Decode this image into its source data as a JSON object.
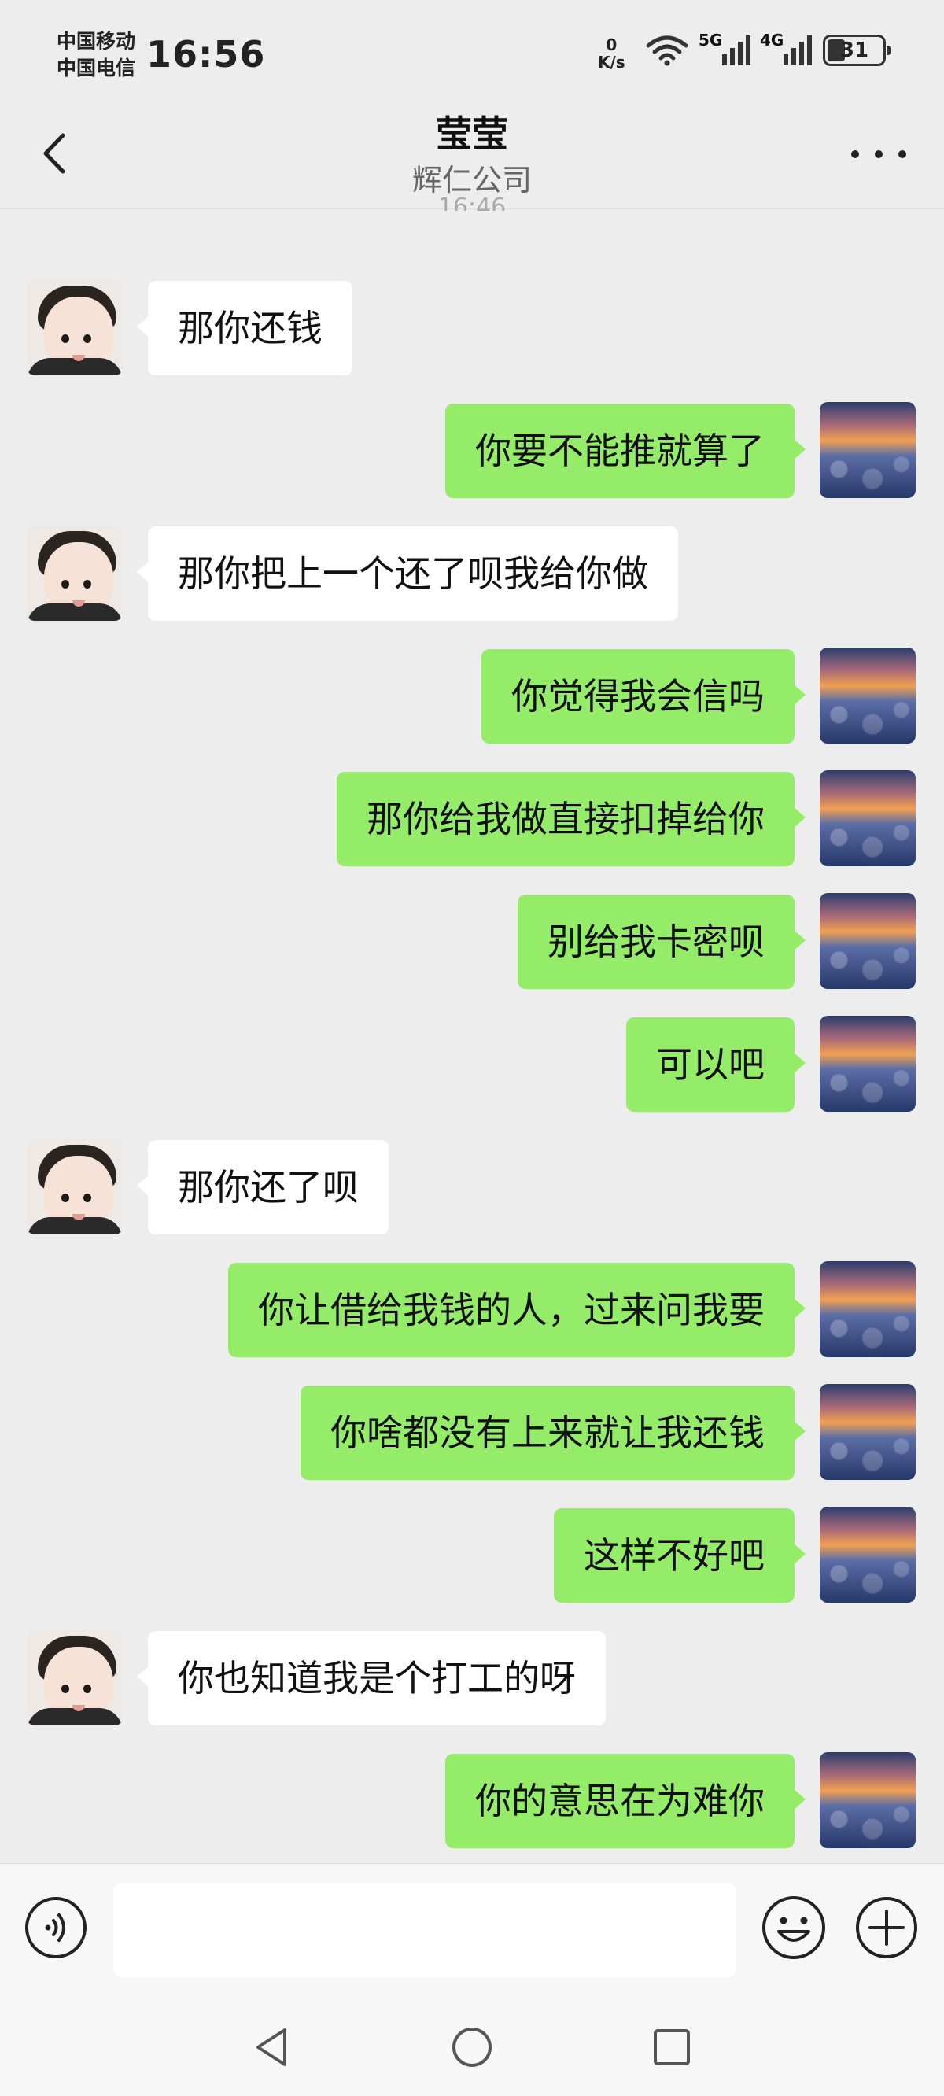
{
  "status_bar": {
    "carrier_1": "中国移动",
    "carrier_2": "中国电信",
    "time": "16:56",
    "net_speed_value": "0",
    "net_speed_unit": "K/s",
    "signal_1_tag": "5G",
    "signal_2_tag": "4G",
    "battery_level": "31",
    "icons": [
      "wifi-icon",
      "signal-5g-icon",
      "signal-4g-icon",
      "battery-icon"
    ]
  },
  "header": {
    "title": "莹莹",
    "subtitle": "辉仁公司",
    "partial_timestamp": "16:46",
    "icons": [
      "back-arrow-icon",
      "more-icon"
    ]
  },
  "messages": [
    {
      "side": "in",
      "text": "那你还钱"
    },
    {
      "side": "out",
      "text": "你要不能推就算了"
    },
    {
      "side": "in",
      "text": "那你把上一个还了呗我给你做"
    },
    {
      "side": "out",
      "text": "你觉得我会信吗"
    },
    {
      "side": "out",
      "text": "那你给我做直接扣掉给你"
    },
    {
      "side": "out",
      "text": "别给我卡密呗"
    },
    {
      "side": "out",
      "text": "可以吧"
    },
    {
      "side": "in",
      "text": "那你还了呗"
    },
    {
      "side": "out",
      "text": "你让借给我钱的人，过来问我要"
    },
    {
      "side": "out",
      "text": "你啥都没有上来就让我还钱"
    },
    {
      "side": "out",
      "text": "这样不好吧"
    },
    {
      "side": "in",
      "text": "你也知道我是个打工的呀"
    },
    {
      "side": "out",
      "text": "你的意思在为难你"
    }
  ],
  "input_bar": {
    "value": "",
    "placeholder": "",
    "icons": [
      "voice-icon",
      "emoji-icon",
      "plus-icon"
    ]
  },
  "system_nav": {
    "icons": [
      "back-triangle-icon",
      "home-circle-icon",
      "recents-square-icon"
    ]
  },
  "colors": {
    "background": "#ededed",
    "outgoing_bubble": "#95ec69",
    "incoming_bubble": "#ffffff",
    "text": "#111111"
  }
}
